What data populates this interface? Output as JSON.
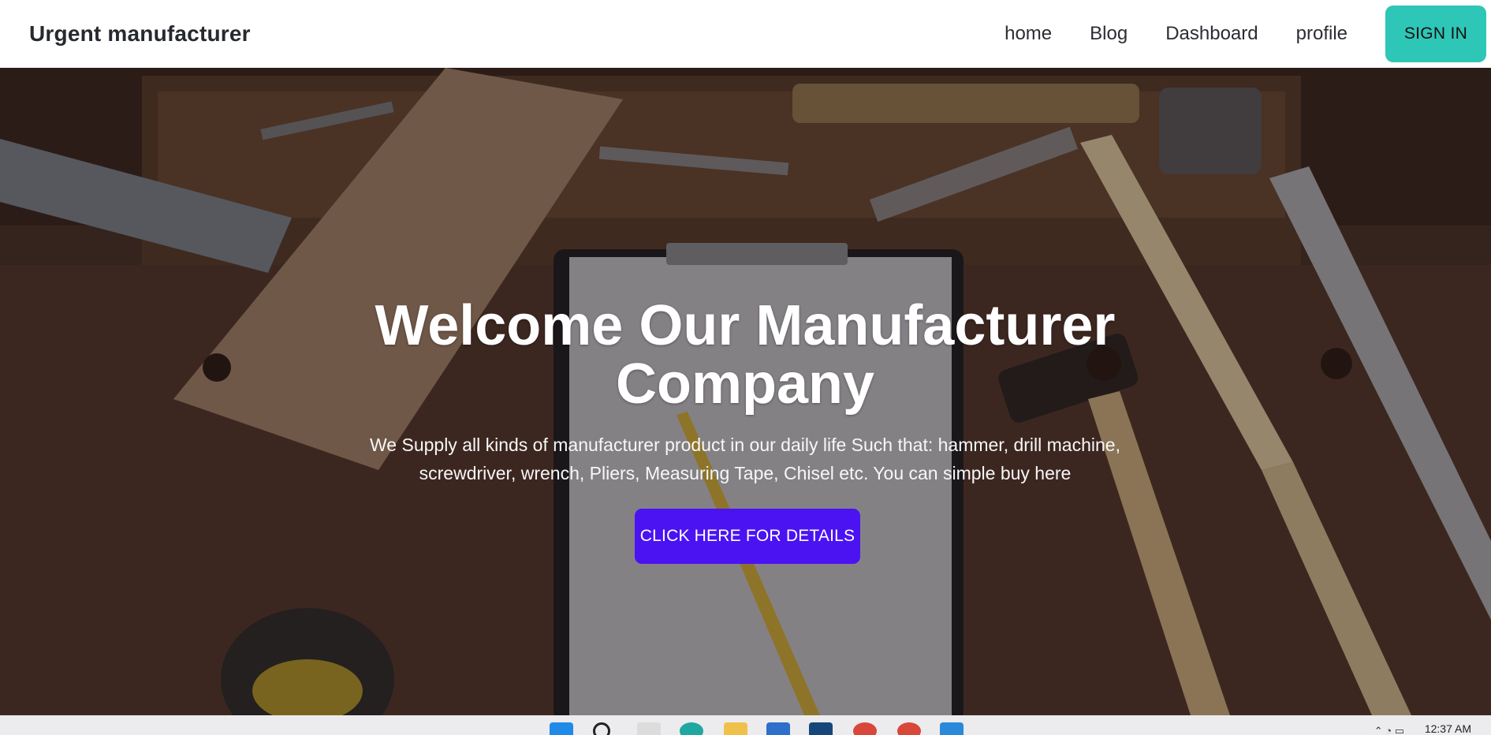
{
  "navbar": {
    "brand": "Urgent manufacturer",
    "links": [
      "home",
      "Blog",
      "Dashboard",
      "profile"
    ],
    "signin_label": "SIGN IN",
    "signin_color": "#2ec6b6"
  },
  "hero": {
    "title": "Welcome Our Manufacturer Company",
    "description": "We Supply all kinds of manufacturer product in our daily life Such that: hammer, drill machine, screwdriver, wrench, Pliers, Measuring Tape, Chisel etc. You can simple buy here",
    "button_label": "CLICK HERE FOR DETAILS",
    "button_color": "#4b13f2",
    "background_image": "workbench with wood plank, clipboard, pencil, hammer, ruler and tape measure"
  },
  "taskbar": {
    "clock": "12:37 AM",
    "icons": [
      "windows-start-icon",
      "search-icon",
      "task-view-icon",
      "edge-icon",
      "file-explorer-icon",
      "store-icon",
      "app-icon",
      "chrome-profile-icon",
      "chrome-profile-icon-2",
      "vscode-icon"
    ]
  }
}
